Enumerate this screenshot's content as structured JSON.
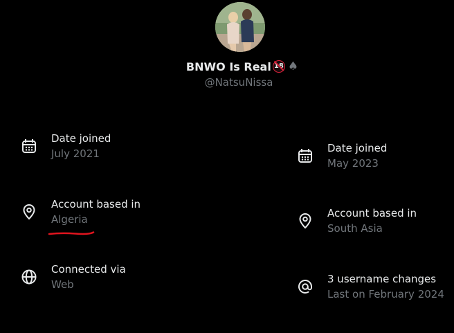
{
  "profile": {
    "display_name": "BNWO Is Real",
    "badge_text": "18",
    "suit_symbol": "♠",
    "handle": "@NatsuNissa"
  },
  "left_column": [
    {
      "icon": "calendar-icon",
      "label": "Date joined",
      "value": "July 2021"
    },
    {
      "icon": "location-pin-icon",
      "label": "Account based in",
      "value": "Algeria"
    },
    {
      "icon": "globe-icon",
      "label": "Connected via",
      "value": "Web"
    }
  ],
  "right_column": [
    {
      "icon": "calendar-icon",
      "label": "Date joined",
      "value": "May 2023"
    },
    {
      "icon": "location-pin-icon",
      "label": "Account based in",
      "value": "South Asia"
    },
    {
      "icon": "at-sign-icon",
      "label": "3 username changes",
      "value": "Last on February 2024"
    }
  ],
  "colors": {
    "background": "#000000",
    "primary_text": "#e7e9ea",
    "secondary_text": "#71767b",
    "annotation_red": "#e0141e"
  }
}
